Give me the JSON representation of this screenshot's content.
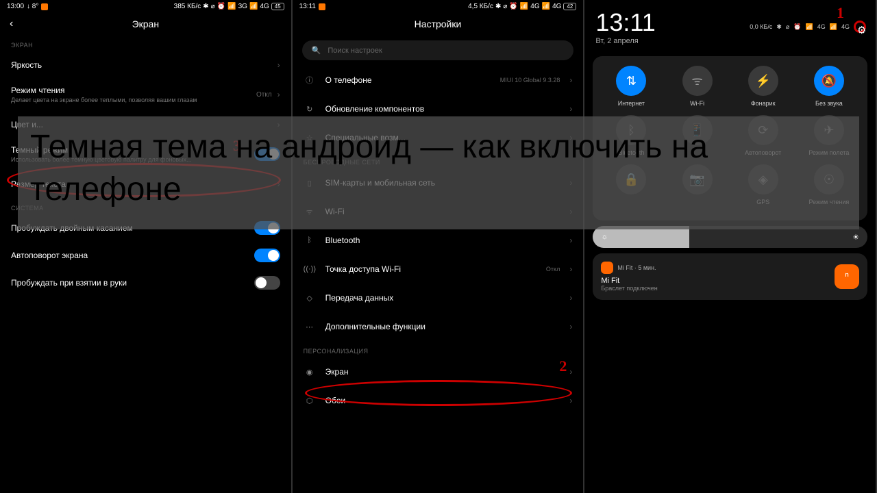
{
  "overlay_title": "Темная тема на андроид — как включить на телефоне",
  "annot": {
    "one": "1",
    "two": "2",
    "three": "3"
  },
  "p1": {
    "status": {
      "time": "13:00",
      "temp": "↓ 8°",
      "net": "385 КБ/с",
      "sig": "3G",
      "sig2": "4G",
      "batt": "45"
    },
    "title": "Экран",
    "sec_screen": "ЭКРАН",
    "brightness": "Яркость",
    "reading": {
      "t": "Режим чтения",
      "s": "Делает цвета на экране более теплыми, позволяя вашим глазам",
      "v": "Откл"
    },
    "color": {
      "t": "Цвет и..."
    },
    "dark": {
      "t": "Темный режим",
      "s": "Использовать более темную цветовую палитру для фоновых..."
    },
    "textsize": "Размер текста",
    "sec_system": "СИСТЕМА",
    "doubletap": "Пробуждать двойным касанием",
    "autorotate": "Автоповорот экрана",
    "raisewake": "Пробуждать при взятии в руки"
  },
  "p2": {
    "status": {
      "time": "13:11",
      "net": "4,5 КБ/с",
      "sig": "4G",
      "sig2": "4G",
      "batt": "42"
    },
    "title": "Настройки",
    "search": "Поиск настроек",
    "about": {
      "t": "О телефоне",
      "v": "MIUI 10 Global 9.3.28"
    },
    "update": "Обновление компонентов",
    "sec_wireless": "БЕСПРОВОДНЫЕ СЕТИ",
    "sim": "SIM-карты и мобильная сеть",
    "wifi": "Wi-Fi",
    "bt": "Bluetooth",
    "hotspot": {
      "t": "Точка доступа Wi-Fi",
      "v": "Откл"
    },
    "data": "Передача данных",
    "more": "Дополнительные функции",
    "sec_personal": "ПЕРСОНАЛИЗАЦИЯ",
    "display": "Экран",
    "wallpaper": "Обои",
    "special": "Специальные возм..."
  },
  "p3": {
    "time": "13:11",
    "date": "Вт, 2 апреля",
    "net": "0,0 КБ/с",
    "sig": "4G",
    "sig2": "4G",
    "tiles": [
      {
        "label": "Интернет",
        "icon": "⇅",
        "active": true
      },
      {
        "label": "Wi-Fi",
        "icon": "ᯤ",
        "active": false
      },
      {
        "label": "Фонарик",
        "icon": "⚡",
        "active": false
      },
      {
        "label": "Без звука",
        "icon": "🔕",
        "active": true
      },
      {
        "label": "Bluetooth",
        "icon": "ᛒ",
        "active": false
      },
      {
        "label": "",
        "icon": "📱",
        "active": false
      },
      {
        "label": "Автоповорот",
        "icon": "⟳",
        "active": false
      },
      {
        "label": "Режим полета",
        "icon": "✈",
        "active": false
      },
      {
        "label": "",
        "icon": "🔒",
        "active": false
      },
      {
        "label": "",
        "icon": "📷",
        "active": false
      },
      {
        "label": "GPS",
        "icon": "◈",
        "active": false
      },
      {
        "label": "Режим чтения",
        "icon": "☉",
        "active": false
      }
    ],
    "notif": {
      "app": "Mi Fit · 5 мин.",
      "title": "Mi Fit",
      "body": "Браслет подключен"
    }
  }
}
